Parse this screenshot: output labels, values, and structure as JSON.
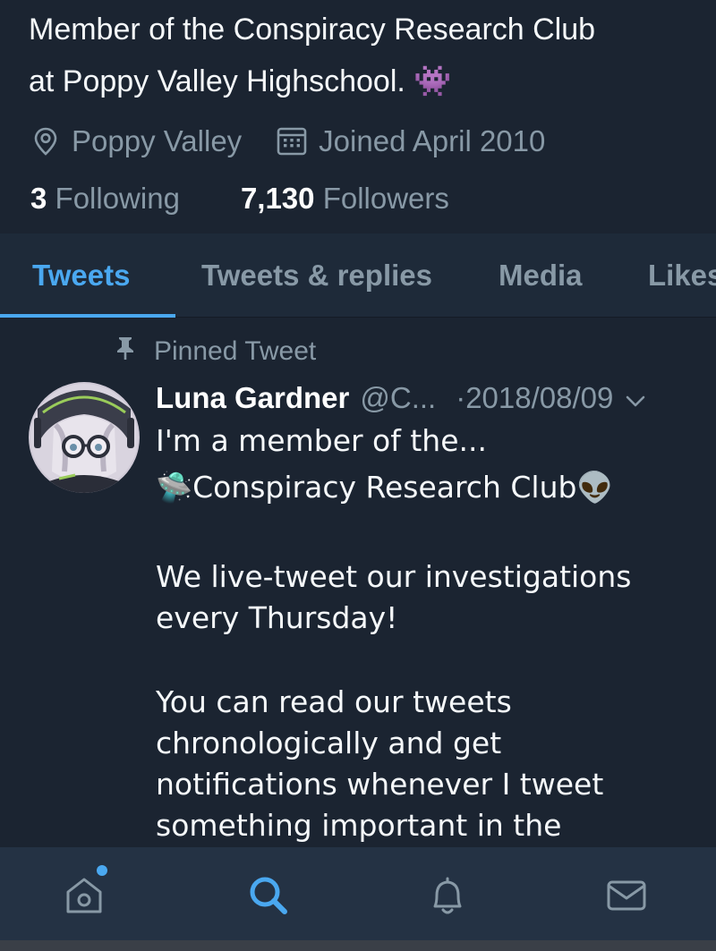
{
  "profile": {
    "bio_line1": "Member of the Conspiracy Research Club",
    "bio_line2": "at Poppy Valley Highschool. 👾",
    "location": "Poppy Valley",
    "joined": "Joined April 2010",
    "following_count": "3",
    "following_label": "Following",
    "followers_count": "7,130",
    "followers_label": "Followers"
  },
  "tabs": [
    {
      "label": "Tweets",
      "active": true
    },
    {
      "label": "Tweets & replies",
      "active": false
    },
    {
      "label": "Media",
      "active": false
    },
    {
      "label": "Likes",
      "active": false
    }
  ],
  "tweet": {
    "pinned_label": "Pinned Tweet",
    "author_name": "Luna Gardner",
    "author_handle": "@C...",
    "date": "·2018/08/09",
    "lines": [
      "I'm a member of the...",
      "🛸Conspiracy Research Club👽",
      "",
      "We live-tweet our investigations",
      "every Thursday!",
      "",
      "You can read our tweets",
      "chronologically and get",
      "notifications whenever I tweet",
      "something important in the"
    ]
  },
  "bottom_nav": [
    {
      "icon": "home-icon",
      "has_notification_dot": true
    },
    {
      "icon": "search-icon",
      "active": true
    },
    {
      "icon": "bell-icon"
    },
    {
      "icon": "mail-icon"
    }
  ],
  "colors": {
    "background": "#1b2431",
    "accent": "#4aa8f0",
    "secondary_text": "#8899a6",
    "tab_bar": "#1e2a39",
    "bottom_bar": "#243244"
  }
}
